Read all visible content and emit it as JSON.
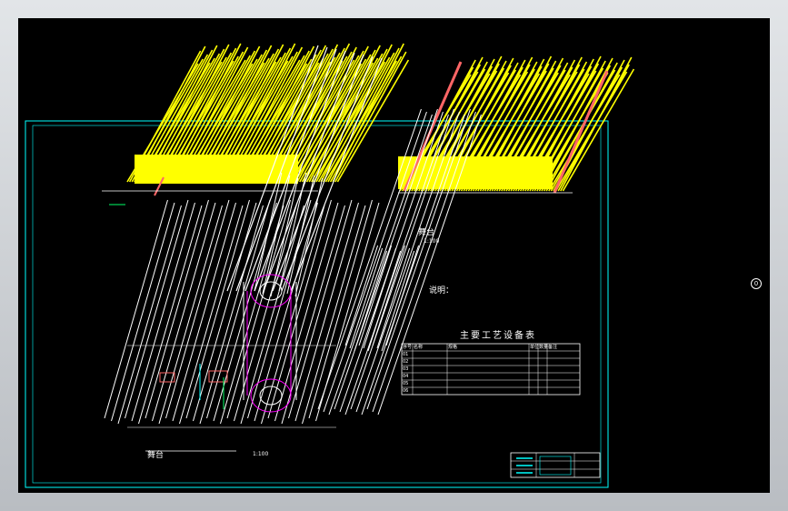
{
  "viewer": {
    "colors": {
      "background": "#000000",
      "frame": "#c8ccd0",
      "cyan": "#00ffff",
      "yellow": "#ffff00",
      "red": "#ff6666",
      "magenta": "#ff00ff",
      "white": "#ffffff",
      "green": "#00ff66"
    }
  },
  "drawing": {
    "view_top_left_label": "",
    "view_top_right_title": "舞台",
    "view_top_right_scale": "1:100",
    "view_bottom_title": "舞台",
    "view_bottom_scale": "1:100",
    "notes_heading": "说明：",
    "notes": [
      "",
      ""
    ],
    "table_title": "主要工艺设备表",
    "circle_mark": "0",
    "table_header": [
      "序号",
      "名称",
      "规格",
      "单位",
      "数量",
      "备注"
    ],
    "table_rows": [
      [
        "01",
        "",
        "",
        "",
        "",
        ""
      ],
      [
        "02",
        "",
        "",
        "",
        "",
        ""
      ],
      [
        "03",
        "",
        "",
        "",
        "",
        ""
      ],
      [
        "04",
        "",
        "",
        "",
        "",
        ""
      ],
      [
        "05",
        "",
        "",
        "",
        "",
        ""
      ],
      [
        "06",
        "",
        "",
        "",
        "",
        ""
      ]
    ]
  }
}
